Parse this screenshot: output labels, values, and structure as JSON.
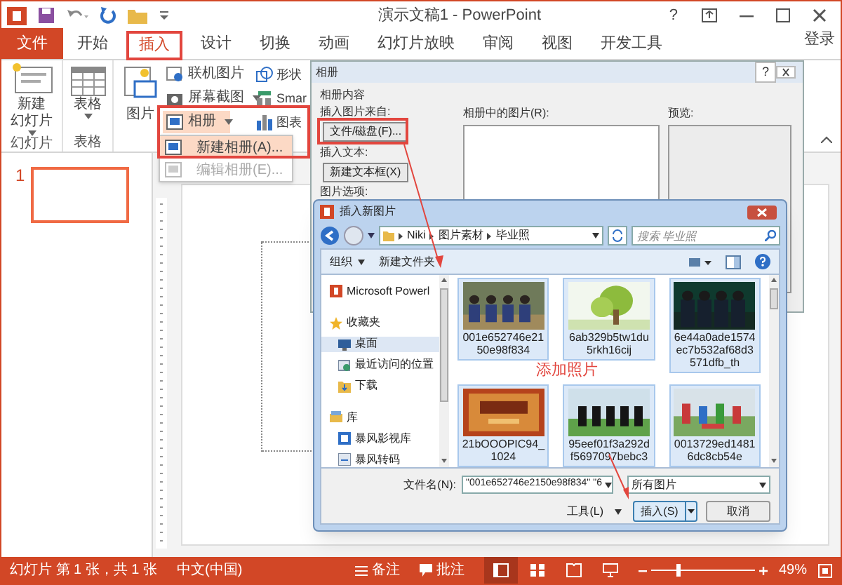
{
  "window": {
    "title": "演示文稿1 - PowerPoint",
    "help": "?"
  },
  "tabs": [
    {
      "label": "文件",
      "kind": "file",
      "selected": false
    },
    {
      "label": "开始",
      "kind": "tab",
      "selected": false
    },
    {
      "label": "插入",
      "kind": "tab",
      "selected": true
    },
    {
      "label": "设计",
      "kind": "tab",
      "selected": false
    },
    {
      "label": "切换",
      "kind": "tab",
      "selected": false
    },
    {
      "label": "动画",
      "kind": "tab",
      "selected": false
    },
    {
      "label": "幻灯片放映",
      "kind": "tab",
      "selected": false
    },
    {
      "label": "审阅",
      "kind": "tab",
      "selected": false
    },
    {
      "label": "视图",
      "kind": "tab",
      "selected": false
    },
    {
      "label": "开发工具",
      "kind": "tab",
      "selected": false
    }
  ],
  "sign_in": "登录",
  "ribbon": {
    "groups": [
      {
        "label": "幻灯片",
        "lines": [
          "新建",
          "幻灯片"
        ],
        "kind": "new-slide"
      },
      {
        "label": "表格",
        "lines": [
          "表格"
        ],
        "kind": "table"
      }
    ],
    "picture_button": "图片",
    "image_items": [
      {
        "label": "联机图片",
        "dropdown": false
      },
      {
        "label": "屏幕截图",
        "dropdown": true
      },
      {
        "label": "相册",
        "dropdown": true
      }
    ],
    "illustration_items": [
      {
        "label": "形状",
        "kind": "shapes"
      },
      {
        "label": "Smar",
        "kind": "smartart"
      },
      {
        "label": "图表",
        "kind": "chart"
      }
    ]
  },
  "album_menu": [
    {
      "label": "新建相册(A)...",
      "selected": true,
      "disabled": false
    },
    {
      "label": "编辑相册(E)...",
      "selected": false,
      "disabled": true
    }
  ],
  "slides": [
    {
      "number": "1",
      "selected": true
    }
  ],
  "album_dialog": {
    "title": "相册",
    "help": "?",
    "section": "相册内容",
    "insert_from": "插入图片来自:",
    "file_button": "文件/磁盘(F)...",
    "insert_text": "插入文本:",
    "textbox_button": "新建文本框(X)",
    "picture_options": "图片选项:",
    "pictures_label": "相册中的图片(R):",
    "preview_label": "预览:"
  },
  "picture_dialog": {
    "title": "插入新图片",
    "breadcrumb": [
      "Niki",
      "图片素材",
      "毕业照"
    ],
    "search": {
      "placeholder": "搜索 毕业照"
    },
    "toolbar": [
      {
        "label": "组织",
        "dropdown": true
      },
      {
        "label": "新建文件夹",
        "dropdown": false
      }
    ],
    "nav": [
      {
        "label": "Microsoft Powerl",
        "kind": "app",
        "selected": false
      },
      {
        "label": "收藏夹",
        "kind": "star",
        "selected": false,
        "children": [
          {
            "label": "桌面",
            "kind": "desktop",
            "selected": true
          },
          {
            "label": "最近访问的位置",
            "kind": "recent",
            "selected": false
          },
          {
            "label": "下载",
            "kind": "download",
            "selected": false
          }
        ]
      },
      {
        "label": "库",
        "kind": "library",
        "selected": false,
        "children": [
          {
            "label": "暴风影视库",
            "kind": "video",
            "selected": false
          },
          {
            "label": "暴风转码",
            "kind": "convert",
            "selected": false
          }
        ]
      }
    ],
    "files": [
      {
        "name": "001e652746e21\n50e98f834",
        "selected": true
      },
      {
        "name": "6ab329b5tw1du\n5rkh16cij",
        "selected": true
      },
      {
        "name": "6e44a0ade1574\nec7b532af68d3\n571dfb_th",
        "selected": true
      },
      {
        "name": "21bOOOPIC94_\n1024",
        "selected": true
      },
      {
        "name": "95eef01f3a292d\nf5697097bebc3",
        "selected": true
      },
      {
        "name": "0013729ed1481\n6dc8cb54e",
        "selected": true
      }
    ],
    "filename_label": "文件名(N):",
    "filename": "\"001e652746e2150e98f834\" \"6",
    "filter": "所有图片",
    "tools": "工具(L)",
    "insert": "插入(S)",
    "cancel": "取消"
  },
  "annotation": "添加照片",
  "status_bar": {
    "slide": "幻灯片 第 1 张，共 1 张",
    "language": "中文(中国)",
    "notes": "备注",
    "comments": "批注",
    "views": [
      {
        "kind": "normal",
        "selected": true
      },
      {
        "kind": "sorter",
        "selected": false
      },
      {
        "kind": "reading",
        "selected": false
      },
      {
        "kind": "show",
        "selected": false
      }
    ],
    "zoom": {
      "level": 0.24,
      "reading": "49%"
    }
  }
}
